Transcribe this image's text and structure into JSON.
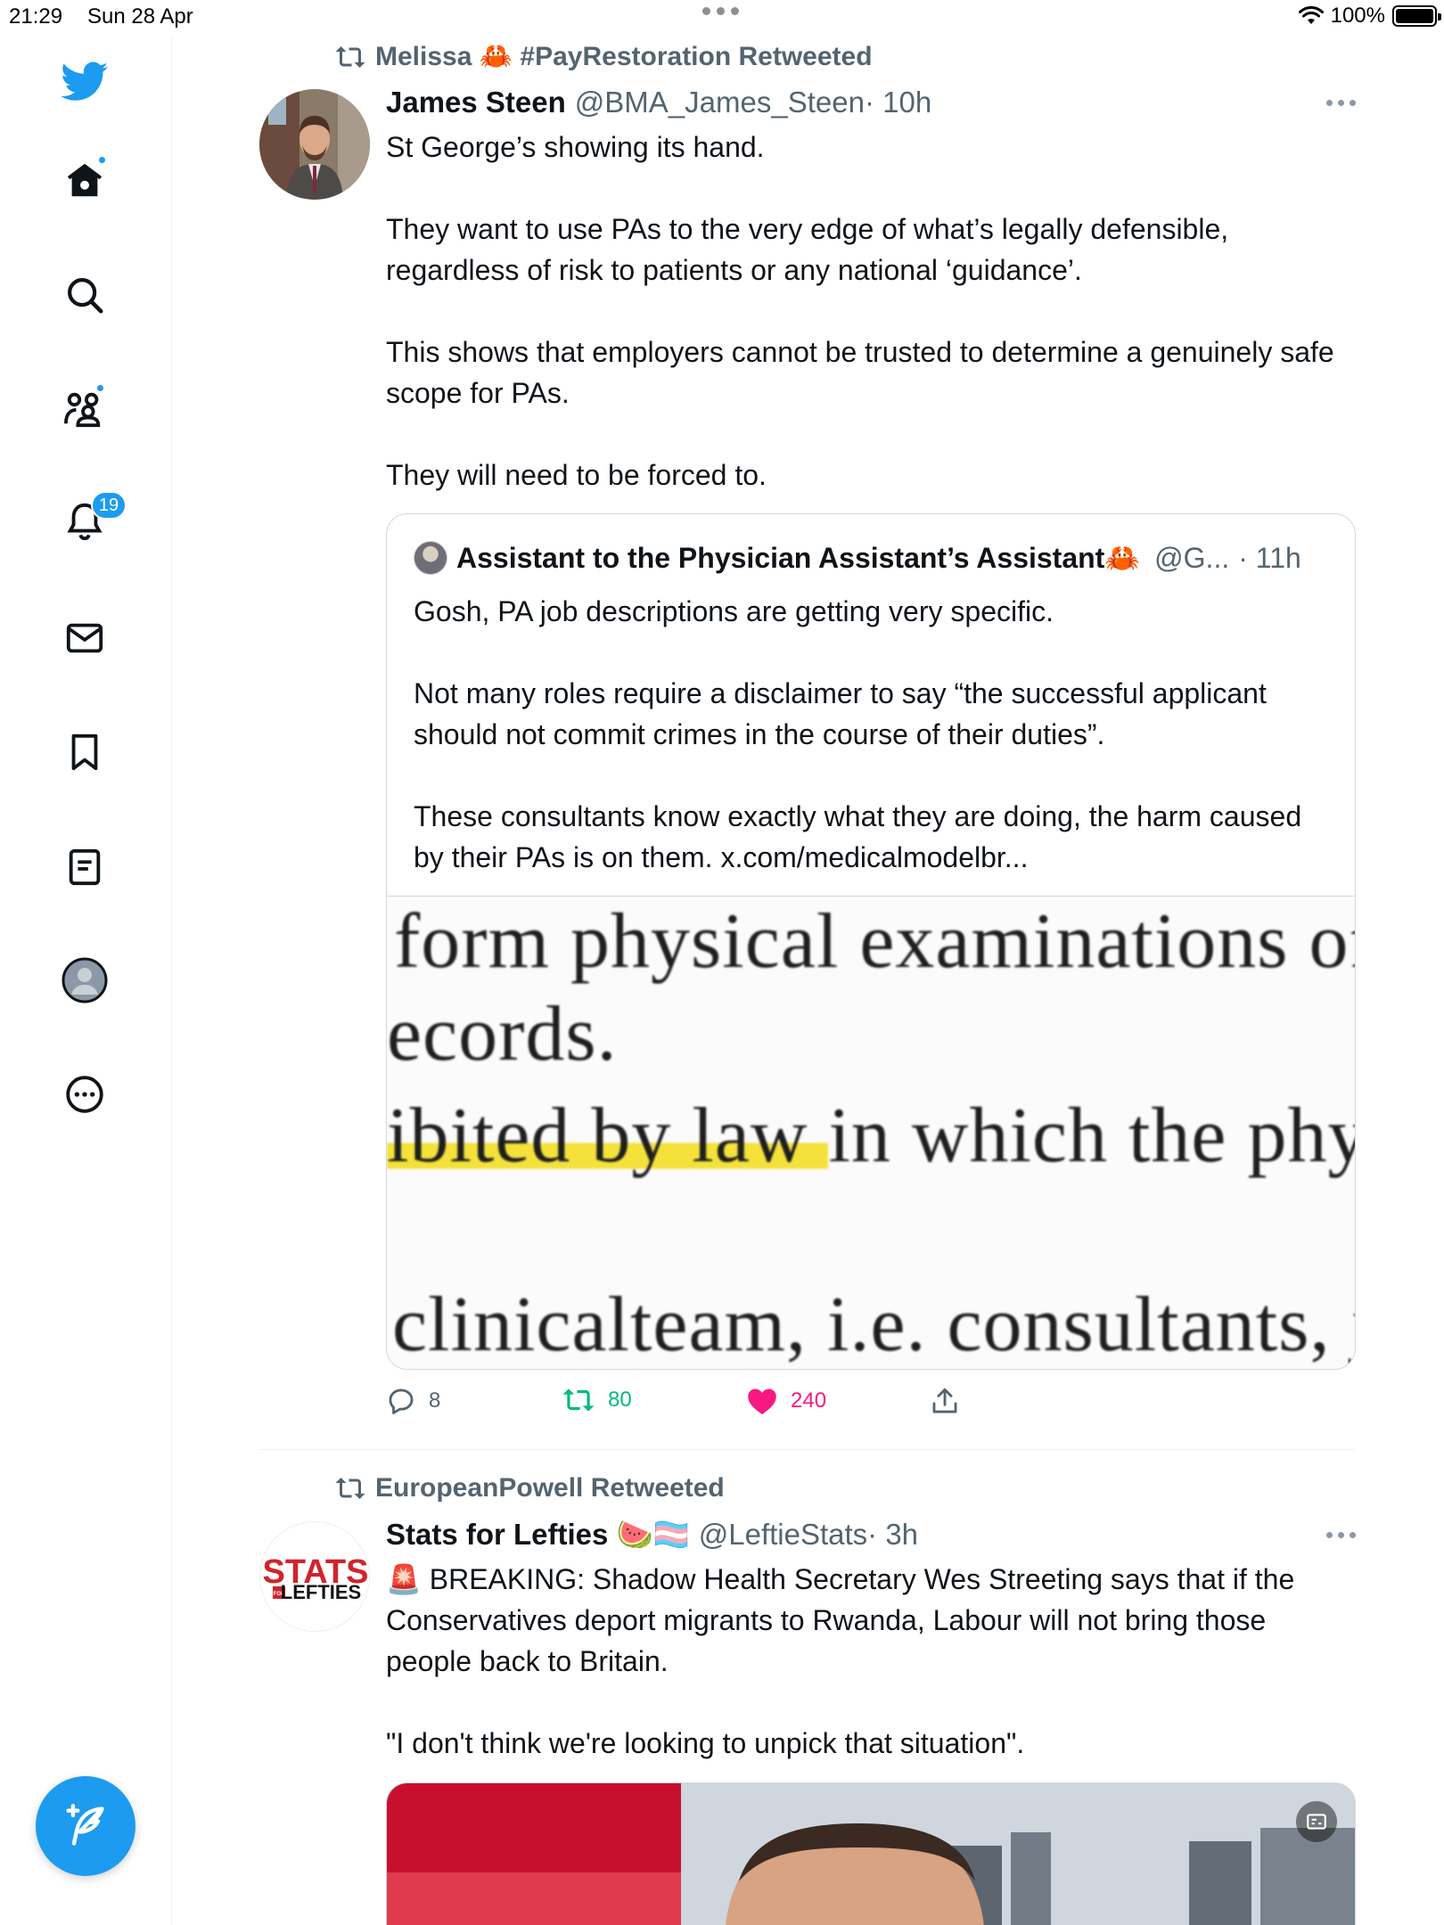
{
  "status_bar": {
    "time": "21:29",
    "date": "Sun 28 Apr",
    "battery": "100%"
  },
  "sidebar": {
    "notifications_count": "19",
    "items": [
      {
        "icon": "twitter-bird-icon"
      },
      {
        "icon": "home-icon"
      },
      {
        "icon": "search-icon"
      },
      {
        "icon": "communities-icon"
      },
      {
        "icon": "notifications-bell-icon"
      },
      {
        "icon": "messages-envelope-icon"
      },
      {
        "icon": "bookmark-icon"
      },
      {
        "icon": "lists-icon"
      },
      {
        "icon": "profile-avatar-icon"
      },
      {
        "icon": "more-circle-icon"
      }
    ],
    "compose_icon": "compose-feather-icon"
  },
  "tweet1": {
    "retweeted_by": "Melissa 🦀 #PayRestoration Retweeted",
    "name": "James Steen",
    "handle": "@BMA_James_Steen",
    "time": "· 10h",
    "body": [
      "St George’s showing its hand.",
      "",
      "They want to use PAs to the very edge of what’s legally defensible, regardless of risk to patients or any national ‘guidance’.",
      "",
      "This shows that employers cannot be trusted to determine a genuinely safe scope for PAs.",
      "",
      "They will need to be forced to."
    ],
    "quote": {
      "name": "Assistant to the Physician Assistant’s Assistant🦀",
      "handle": "@G...",
      "time": "· 11h",
      "body": [
        "Gosh, PA job descriptions are getting very specific.",
        "",
        "Not many roles require a disclaimer to say “the successful applicant should not commit crimes in the course of their duties”.",
        "",
        "These consultants know exactly what they are doing, the harm caused by their PAs is on them. x.com/medicalmodelbr..."
      ],
      "image_text": {
        "line1": "form physical examinations of",
        "line2": "ecords.",
        "line3_highlight": "ibited by law ",
        "line3_rest": "in which the physi",
        "line4": "clinicalteam, i.e. consultants, j"
      }
    },
    "actions": {
      "replies": "8",
      "retweets": "80",
      "likes": "240"
    },
    "colors": {
      "retweet": "#00ba7c",
      "like": "#f91880"
    }
  },
  "tweet2": {
    "retweeted_by": "EuropeanPowell Retweeted",
    "name": "Stats for Lefties 🍉🏳️‍⚧️",
    "handle": "@LeftieStats",
    "time": "· 3h",
    "avatar_text": {
      "line1": "STATS",
      "line2": "LEFTIES",
      "small": "FOR"
    },
    "body": [
      "🚨 BREAKING: Shadow Health Secretary Wes Streeting says that if the Conservatives deport migrants to Rwanda, Labour will not bring those people back to Britain.",
      "",
      "\"I don't think we're looking to unpick that situation\"."
    ]
  },
  "colors": {
    "accent": "#1d9bf0",
    "text": "#0f1419",
    "secondary": "#536471"
  }
}
